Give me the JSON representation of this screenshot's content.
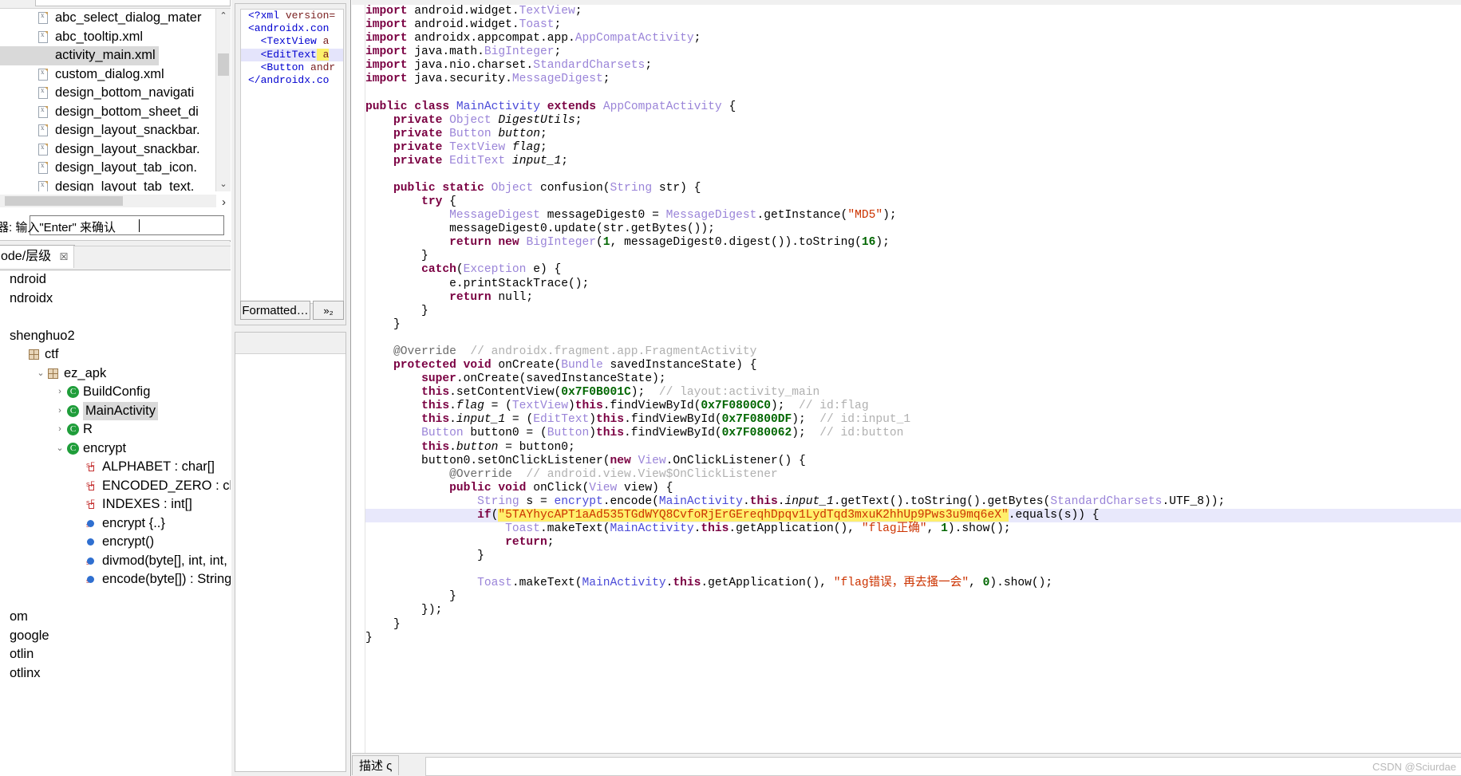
{
  "resource_list": {
    "items": [
      {
        "label": "abc_select_dialog_mater",
        "selected": false
      },
      {
        "label": "abc_tooltip.xml",
        "selected": false
      },
      {
        "label": "activity_main.xml",
        "selected": true
      },
      {
        "label": "custom_dialog.xml",
        "selected": false
      },
      {
        "label": "design_bottom_navigati",
        "selected": false
      },
      {
        "label": "design_bottom_sheet_di",
        "selected": false
      },
      {
        "label": "design_layout_snackbar.",
        "selected": false
      },
      {
        "label": "design_layout_snackbar.",
        "selected": false
      },
      {
        "label": "design_layout_tab_icon.",
        "selected": false
      },
      {
        "label": "design_layout_tab_text.",
        "selected": false
      }
    ],
    "scroll_right_arrow": "›",
    "scroll_up_arrow": "⌃",
    "scroll_down_arrow": "⌄"
  },
  "search_bar": {
    "label": "器:",
    "value": "输入\"Enter\" 来确认"
  },
  "code_tree": {
    "tab_label": "ode/层级",
    "tab_close": "☒",
    "rows": [
      {
        "label": "ndroid",
        "indent": 0,
        "icon": "none",
        "twisty": "",
        "selected": false
      },
      {
        "label": "ndroidx",
        "indent": 0,
        "icon": "none",
        "twisty": "",
        "selected": false
      },
      {
        "label": "",
        "indent": 0,
        "icon": "none",
        "twisty": "",
        "selected": false
      },
      {
        "label": "shenghuo2",
        "indent": 0,
        "icon": "none",
        "twisty": "",
        "selected": false
      },
      {
        "label": "ctf",
        "indent": 1,
        "icon": "package",
        "twisty": "",
        "selected": false
      },
      {
        "label": "ez_apk",
        "indent": 2,
        "icon": "package",
        "twisty": "⌄",
        "selected": false
      },
      {
        "label": "BuildConfig",
        "indent": 3,
        "icon": "class",
        "twisty": "›",
        "selected": false
      },
      {
        "label": "MainActivity",
        "indent": 3,
        "icon": "class",
        "twisty": "›",
        "selected": true
      },
      {
        "label": "R",
        "indent": 3,
        "icon": "class",
        "twisty": "›",
        "selected": false
      },
      {
        "label": "encrypt",
        "indent": 3,
        "icon": "class",
        "twisty": "⌄",
        "selected": false
      },
      {
        "label": "ALPHABET : char[]",
        "indent": 4,
        "icon": "static-field",
        "twisty": "",
        "selected": false
      },
      {
        "label": "ENCODED_ZERO : char",
        "indent": 4,
        "icon": "static-field",
        "twisty": "",
        "selected": false
      },
      {
        "label": "INDEXES : int[]",
        "indent": 4,
        "icon": "static-field",
        "twisty": "",
        "selected": false
      },
      {
        "label": "encrypt {..}",
        "indent": 4,
        "icon": "method-static",
        "twisty": "",
        "selected": false
      },
      {
        "label": "encrypt()",
        "indent": 4,
        "icon": "method",
        "twisty": "",
        "selected": false
      },
      {
        "label": "divmod(byte[], int, int, int)",
        "indent": 4,
        "icon": "method-static",
        "twisty": "",
        "selected": false
      },
      {
        "label": "encode(byte[]) : String",
        "indent": 4,
        "icon": "method-static",
        "twisty": "",
        "selected": false
      },
      {
        "label": "",
        "indent": 0,
        "icon": "none",
        "twisty": "",
        "selected": false
      },
      {
        "label": "om",
        "indent": 0,
        "icon": "none",
        "twisty": "",
        "selected": false
      },
      {
        "label": "google",
        "indent": 0,
        "icon": "none",
        "twisty": "",
        "selected": false
      },
      {
        "label": "otlin",
        "indent": 0,
        "icon": "none",
        "twisty": "",
        "selected": false
      },
      {
        "label": "otlinx",
        "indent": 0,
        "icon": "none",
        "twisty": "",
        "selected": false
      }
    ]
  },
  "xml_preview": {
    "lines": [
      {
        "text": "<?xml version=",
        "type": "decl",
        "selected": false
      },
      {
        "text": "<androidx.con",
        "type": "tag",
        "selected": false
      },
      {
        "text": "  <TextView a",
        "type": "tag",
        "selected": false
      },
      {
        "text": "  <EditText a",
        "type": "tag",
        "selected": true
      },
      {
        "text": "  <Button andr",
        "type": "tag",
        "selected": false
      },
      {
        "text": "</androidx.co",
        "type": "tag",
        "selected": false
      }
    ],
    "format_button": "Formatted…",
    "more_button": "»₂"
  },
  "editor": {
    "code_lines": [
      {
        "text": "import android.widget.TextView;",
        "kind": "import"
      },
      {
        "text": "import android.widget.Toast;",
        "kind": "import"
      },
      {
        "text": "import androidx.appcompat.app.AppCompatActivity;",
        "kind": "import"
      },
      {
        "text": "import java.math.BigInteger;",
        "kind": "import"
      },
      {
        "text": "import java.nio.charset.StandardCharsets;",
        "kind": "import"
      },
      {
        "text": "import java.security.MessageDigest;",
        "kind": "import"
      },
      {
        "text": "",
        "kind": "blank"
      },
      {
        "text": "public class MainActivity extends AppCompatActivity {",
        "kind": "class-decl"
      },
      {
        "text": "    private Object DigestUtils;",
        "kind": "field"
      },
      {
        "text": "    private Button button;",
        "kind": "field"
      },
      {
        "text": "    private TextView flag;",
        "kind": "field"
      },
      {
        "text": "    private EditText input_1;",
        "kind": "field"
      },
      {
        "text": "",
        "kind": "blank"
      },
      {
        "text": "    public static Object confusion(String str) {",
        "kind": "method-decl"
      },
      {
        "text": "        try {",
        "kind": "code"
      },
      {
        "text": "            MessageDigest messageDigest0 = MessageDigest.getInstance(\"MD5\");",
        "kind": "code"
      },
      {
        "text": "            messageDigest0.update(str.getBytes());",
        "kind": "code"
      },
      {
        "text": "            return new BigInteger(1, messageDigest0.digest()).toString(16);",
        "kind": "code"
      },
      {
        "text": "        }",
        "kind": "code"
      },
      {
        "text": "        catch(Exception e) {",
        "kind": "code"
      },
      {
        "text": "            e.printStackTrace();",
        "kind": "code"
      },
      {
        "text": "            return null;",
        "kind": "code"
      },
      {
        "text": "        }",
        "kind": "code"
      },
      {
        "text": "    }",
        "kind": "code"
      },
      {
        "text": "",
        "kind": "blank"
      },
      {
        "text": "    @Override  // androidx.fragment.app.FragmentActivity",
        "kind": "annotation"
      },
      {
        "text": "    protected void onCreate(Bundle savedInstanceState) {",
        "kind": "method-decl"
      },
      {
        "text": "        super.onCreate(savedInstanceState);",
        "kind": "code"
      },
      {
        "text": "        this.setContentView(0x7F0B001C);  // layout:activity_main",
        "kind": "code"
      },
      {
        "text": "        this.flag = (TextView)this.findViewById(0x7F0800C0);  // id:flag",
        "kind": "code"
      },
      {
        "text": "        this.input_1 = (EditText)this.findViewById(0x7F0800DF);  // id:input_1",
        "kind": "code"
      },
      {
        "text": "        Button button0 = (Button)this.findViewById(0x7F080062);  // id:button",
        "kind": "code"
      },
      {
        "text": "        this.button = button0;",
        "kind": "code"
      },
      {
        "text": "        button0.setOnClickListener(new View.OnClickListener() {",
        "kind": "code"
      },
      {
        "text": "            @Override  // android.view.View$OnClickListener",
        "kind": "annotation"
      },
      {
        "text": "            public void onClick(View view) {",
        "kind": "code"
      },
      {
        "text": "                String s = encrypt.encode(MainActivity.this.input_1.getText().toString().getBytes(StandardCharsets.UTF_8));",
        "kind": "code"
      },
      {
        "text": "                if(\"5TAYhycAPT1aAd535TGdWYQ8CvfoRjErGEreqhDpqv1LydTqd3mxuK2hhUp9Pws3u9mq6eX\".equals(s)) {",
        "kind": "highlight"
      },
      {
        "text": "                    Toast.makeText(MainActivity.this.getApplication(), \"flag正确\", 1).show();",
        "kind": "code"
      },
      {
        "text": "                    return;",
        "kind": "code"
      },
      {
        "text": "                }",
        "kind": "code"
      },
      {
        "text": "",
        "kind": "blank"
      },
      {
        "text": "                Toast.makeText(MainActivity.this.getApplication(), \"flag错误，再去搔一会\", 0).show();",
        "kind": "code"
      },
      {
        "text": "            }",
        "kind": "code"
      },
      {
        "text": "        });",
        "kind": "code"
      },
      {
        "text": "    }",
        "kind": "code"
      },
      {
        "text": "}",
        "kind": "code"
      }
    ],
    "flag_string": "5TAYhycAPT1aAd535TGdWYQ8CvfoRjErGEreqhDpqv1LydTqd3mxuK2hhUp9Pws3u9mq6eX",
    "md5_algorithm": "MD5",
    "toast_success": "flag正确",
    "toast_failure": "flag错误，再去搔一会",
    "layout_id": "0x7F0B001C",
    "flag_view_id": "0x7F0800C0",
    "input_view_id": "0x7F0800DF",
    "button_view_id": "0x7F080062"
  },
  "bottom_bar": {
    "tab_label": "描述  ς"
  },
  "watermark": "CSDN @Sciurdae",
  "colors": {
    "keyword": "#7a0042",
    "type": "#9a84d8",
    "string": "#cc3300",
    "number": "#006600",
    "comment": "#b0b0b0",
    "highlight_bg": "#ffef6b",
    "selection_bg": "#e8e8fb",
    "panel_bg": "#f0f0f0"
  }
}
